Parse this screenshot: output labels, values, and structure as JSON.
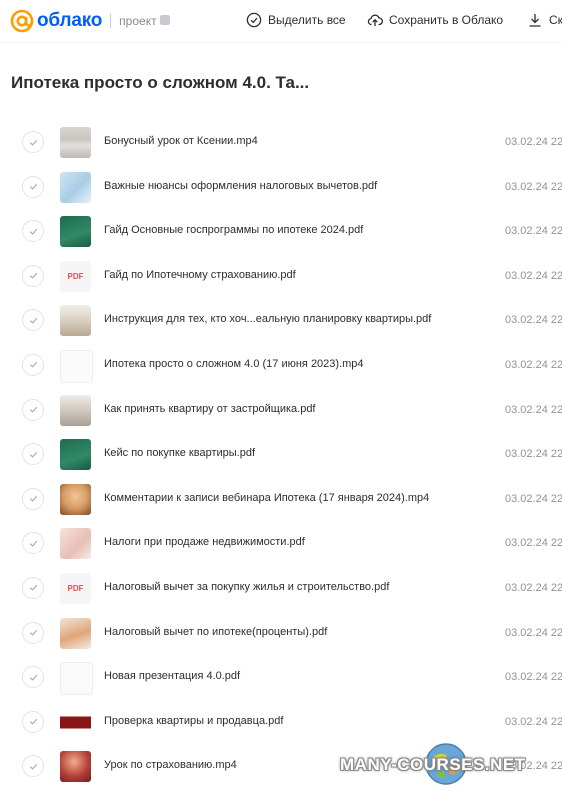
{
  "header": {
    "logo_text": "облако",
    "project_label": "проект",
    "select_all_label": "Выделить все",
    "save_label": "Сохранить в Облако",
    "download_label": "Ск"
  },
  "folder_title": "Ипотека просто о сложном 4.0. Та...",
  "colors": {
    "brand": "#005ff9",
    "logo_at": "#ff9e00",
    "pdf_red": "#ed4b4b"
  },
  "files": [
    {
      "name": "Бонусный урок от Ксении.mp4",
      "date": "03.02.24 22",
      "thumb": "photo-gray"
    },
    {
      "name": "Важные нюансы оформления налоговых вычетов.pdf",
      "date": "03.02.24 22",
      "thumb": "blue-doc"
    },
    {
      "name": "Гайд Основные госпрограммы по ипотеке 2024.pdf",
      "date": "03.02.24 22",
      "thumb": "green-doc"
    },
    {
      "name": "Гайд по Ипотечному страхованию.pdf",
      "date": "03.02.24 22",
      "thumb": "pdf",
      "thumb_text": "PDF"
    },
    {
      "name": "Инструкция для тех, кто хоч...еальную планировку квартиры.pdf",
      "date": "03.02.24 22",
      "thumb": "photo-room"
    },
    {
      "name": "Ипотека просто о сложном 4.0 (17 июня 2023).mp4",
      "date": "03.02.24 22",
      "thumb": "white-slide"
    },
    {
      "name": "Как принять квартиру от застройщика.pdf",
      "date": "03.02.24 22",
      "thumb": "photo-building"
    },
    {
      "name": "Кейс по покупке квартиры.pdf",
      "date": "03.02.24 22",
      "thumb": "green-doc"
    },
    {
      "name": "Комментарии к записи вебинара Ипотека (17 января 2024).mp4",
      "date": "03.02.24 22",
      "thumb": "photo-person"
    },
    {
      "name": "Налоги при продаже недвижимости.pdf",
      "date": "03.02.24 22",
      "thumb": "pink-person"
    },
    {
      "name": "Налоговый вычет за покупку жилья и строительство.pdf",
      "date": "03.02.24 22",
      "thumb": "pdf",
      "thumb_text": "PDF"
    },
    {
      "name": "Налоговый вычет по ипотеке(проценты).pdf",
      "date": "03.02.24 22",
      "thumb": "orange-doc"
    },
    {
      "name": "Новая презентация 4.0.pdf",
      "date": "03.02.24 22",
      "thumb": "white-slide-red"
    },
    {
      "name": "Проверка квартиры и продавца.pdf",
      "date": "03.02.24 22",
      "thumb": "red-banner"
    },
    {
      "name": "Урок по страхованию.mp4",
      "date": "03.02.24 22",
      "thumb": "photo-red"
    }
  ],
  "watermark": "MANY-COURSES.NET"
}
